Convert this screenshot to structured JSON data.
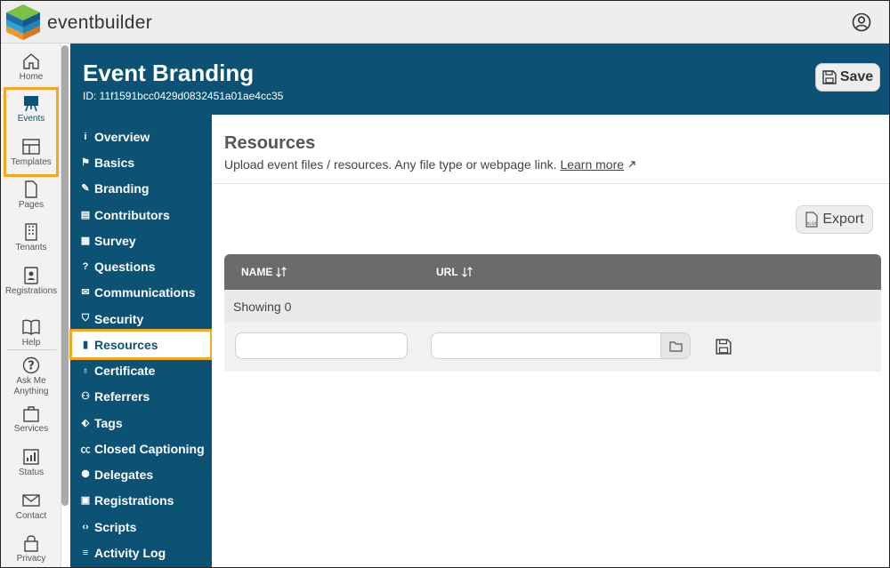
{
  "app": {
    "brand": "eventbuilder"
  },
  "rail": [
    {
      "label": "Home",
      "icon": "home-icon"
    },
    {
      "label": "Events",
      "icon": "easel-icon"
    },
    {
      "label": "Templates",
      "icon": "templates-icon"
    },
    {
      "label": "Pages",
      "icon": "page-icon"
    },
    {
      "label": "Tenants",
      "icon": "building-icon"
    },
    {
      "label": "Registrations",
      "icon": "badge-icon"
    },
    {
      "label": "Help",
      "icon": "book-icon"
    },
    {
      "label": "Ask Me Anything",
      "label_line1": "Ask Me",
      "label_line2": "Anything",
      "icon": "question-icon"
    },
    {
      "label": "Services",
      "icon": "bag-icon"
    },
    {
      "label": "Status",
      "icon": "status-chart-icon"
    },
    {
      "label": "Contact",
      "icon": "envelope-icon"
    },
    {
      "label": "Privacy",
      "icon": "lock-icon"
    }
  ],
  "header": {
    "title": "Event Branding",
    "event_id": "ID: 11f1591bcc0429d0832451a01ae4cc35",
    "save_label": "Save"
  },
  "subnav": [
    {
      "label": "Overview",
      "icon": "info-icon",
      "glyph": "i"
    },
    {
      "label": "Basics",
      "icon": "signpost-icon",
      "glyph": "⚑"
    },
    {
      "label": "Branding",
      "icon": "brush-icon",
      "glyph": "✎"
    },
    {
      "label": "Contributors",
      "icon": "id-card-icon",
      "glyph": "▤"
    },
    {
      "label": "Survey",
      "icon": "survey-icon",
      "glyph": "▦"
    },
    {
      "label": "Questions",
      "icon": "question-icon",
      "glyph": "?"
    },
    {
      "label": "Communications",
      "icon": "envelope-icon",
      "glyph": "✉"
    },
    {
      "label": "Security",
      "icon": "shield-icon",
      "glyph": "⛉"
    },
    {
      "label": "Resources",
      "icon": "resources-icon",
      "glyph": "▮",
      "active": true
    },
    {
      "label": "Certificate",
      "icon": "award-icon",
      "glyph": "♁"
    },
    {
      "label": "Referrers",
      "icon": "referrers-icon",
      "glyph": "⚇"
    },
    {
      "label": "Tags",
      "icon": "tag-icon",
      "glyph": "⬖"
    },
    {
      "label": "Closed Captioning",
      "icon": "cc-icon",
      "glyph": "㏄"
    },
    {
      "label": "Delegates",
      "icon": "delegates-icon",
      "glyph": "⚉"
    },
    {
      "label": "Registrations",
      "icon": "badge-icon",
      "glyph": "▣"
    },
    {
      "label": "Scripts",
      "icon": "code-icon",
      "glyph": "‹›"
    },
    {
      "label": "Activity Log",
      "icon": "list-icon",
      "glyph": "≡"
    }
  ],
  "resources": {
    "title": "Resources",
    "description": "Upload event files / resources. Any file type or webpage link.",
    "learn_more": "Learn more",
    "export_label": "Export",
    "columns": [
      "NAME",
      "URL"
    ],
    "showing": "Showing 0"
  },
  "colors": {
    "brand_blue": "#0c5275",
    "highlight": "#f5a623",
    "table_header": "#6b6b6b"
  }
}
